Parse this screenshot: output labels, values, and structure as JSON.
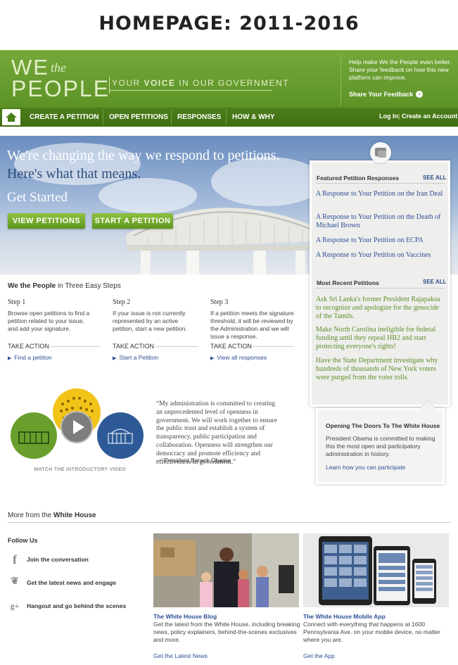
{
  "caption": "HOMEPAGE: 2011-2016",
  "logo": {
    "we": "WE",
    "the": "the",
    "people": "PEOPLE"
  },
  "tagline": {
    "pre": "YOUR ",
    "bold": "VOICE",
    "post": " IN OUR GOVERNMENT"
  },
  "help_text": "Help make We the People even better. Share your feedback on how this new platform can improve.",
  "share_feedback": "Share Your Feedback",
  "nav": {
    "items": [
      "CREATE A PETITION",
      "OPEN PETITIONS",
      "RESPONSES",
      "HOW & WHY"
    ],
    "login": "Log In",
    "create_account": "Create an Account"
  },
  "hero": {
    "headline_white": "We're changing the way we respond to petitions.",
    "headline_blue": "Here's what that means.",
    "get_started": "Get Started",
    "view_petitions": "VIEW PETITIONS",
    "start_petition": "START A PETITION"
  },
  "featured": {
    "heading": "Featured Petition Responses",
    "see_all": "SEE ALL",
    "items": [
      "A Response to Your Petition on the Iran Deal",
      "A Response to Your Petition on the Death of Michael Brown",
      "A Response to Your Petition on ECPA",
      "A Response to Your Petition on Vaccines"
    ]
  },
  "recent": {
    "heading": "Most Recent Petitions",
    "see_all": "SEE ALL",
    "items": [
      "Ask Sri Lanka's former President Rajapaksa to recognize and apologize for the genocide of the Tamils.",
      "Make North Carolina ineligible for federal funding until they repeal HB2 and start protecting everyone's rights!",
      "Have the State Department investigate why hundreds of thousands of New York voters were purged from the voter rolls."
    ]
  },
  "doors": {
    "title": "Opening The Doors To The White House",
    "text": "President Obama is committed to making this the most open and participatory administration in history.",
    "link": "Learn how you can participate"
  },
  "steps": {
    "title_bold": "We the People",
    "title_rest": " in Three Easy Steps",
    "take_action": "TAKE ACTION",
    "list": [
      {
        "heading": "Step 1",
        "text": "Browse open petitions to find a petition related to your issue, and add your signature.",
        "link": "Find a petition"
      },
      {
        "heading": "Step 2",
        "text": "If your issue is not currently represented by an active petition, start a new petition.",
        "link": "Start a Petition"
      },
      {
        "heading": "Step 3",
        "text": "If a petition meets the signature threshold, it will be reviewed by the Administration and we will issue a response.",
        "link": "View all responses"
      }
    ]
  },
  "quote": {
    "text": "“My administration is committed to creating an unprecedented level of openness in government. We will work together to ensure the public trust and establish a system of transparency, public participation and collaboration. Openness will strengthen our democracy and promote efficiency and effectiveness in government.”",
    "by": "— President Barack Obama"
  },
  "video_caption": "WATCH THE INTRODUCTORY VIDEO",
  "more": {
    "title_pre": "More from the ",
    "title_bold": "White House",
    "follow_us": "Follow Us",
    "social": [
      {
        "icon": "facebook-icon",
        "glyph": "f",
        "label": "Join the conversation"
      },
      {
        "icon": "twitter-icon",
        "glyph": "❦",
        "label": "Get the latest news and engage"
      },
      {
        "icon": "google-plus-icon",
        "glyph": "g+",
        "label": "Hangout and go behind the scenes"
      }
    ],
    "cards": [
      {
        "title": "The White House Blog",
        "text": "Get the latest from the White House, including breaking news, policy explainers, behind-the-scenes exclusives and more.",
        "link": "Get the Latest News"
      },
      {
        "title": "The White House Mobile App",
        "text": "Connect with everything that happens at 1600 Pennsylvania Ave. on your mobile device, no matter where you are.",
        "link": "Get the App"
      }
    ]
  },
  "colors": {
    "green": "#5d9226",
    "link_blue": "#2d4f96",
    "petition_green": "#5d8f2a"
  }
}
